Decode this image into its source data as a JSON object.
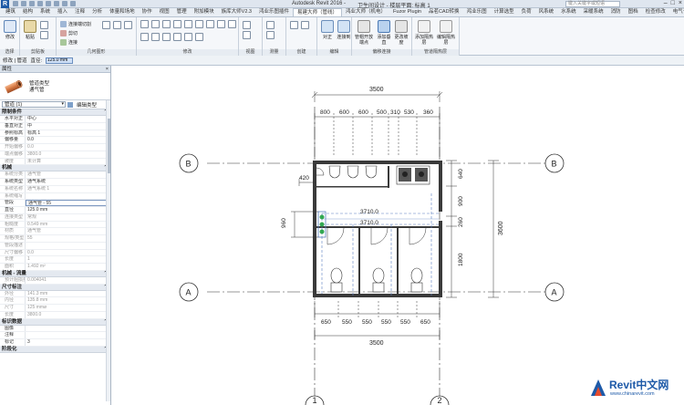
{
  "titlebar": {
    "app_name": "Autodesk Revit 2016 -",
    "file_name": "卫生间设计 - 楼层平面: 标高 1",
    "search_placeholder": "键入关键字或短语"
  },
  "tabs": [
    {
      "label": "建筑"
    },
    {
      "label": "结构"
    },
    {
      "label": "系统"
    },
    {
      "label": "插入"
    },
    {
      "label": "注释"
    },
    {
      "label": "分析"
    },
    {
      "label": "体量和场地"
    },
    {
      "label": "协作"
    },
    {
      "label": "视图"
    },
    {
      "label": "管理"
    },
    {
      "label": "附加模块"
    },
    {
      "label": "族库大师V2.3"
    },
    {
      "label": "鸿业乐图插件"
    },
    {
      "label": "易建大师（管线）"
    },
    {
      "label": "鸿业大师（机电）"
    },
    {
      "label": "Fuzor Plugin"
    },
    {
      "label": "品茗CAD转换"
    },
    {
      "label": "鸿业乐图"
    },
    {
      "label": "计算选型"
    },
    {
      "label": "负荷"
    },
    {
      "label": "风系统"
    },
    {
      "label": "水系统"
    },
    {
      "label": "采暖系统"
    },
    {
      "label": "消防"
    },
    {
      "label": "图档"
    },
    {
      "label": "检查修改"
    },
    {
      "label": "电气专业"
    }
  ],
  "ribbon": {
    "panels": [
      {
        "label": "选择"
      },
      {
        "label": "剪贴板"
      },
      {
        "label": "几何图形"
      },
      {
        "label": "修改"
      },
      {
        "label": "视图"
      },
      {
        "label": "测量"
      },
      {
        "label": "创建"
      },
      {
        "label": "编辑"
      },
      {
        "label": "偏移连接"
      },
      {
        "label": "管道隔热层"
      }
    ],
    "buttons": {
      "modify": "修改",
      "paste": "粘贴",
      "cut": "连接端切割",
      "cut2": "剪切",
      "join": "连接",
      "align": "对正",
      "connect": "连接到",
      "pipe": "管帽开放端点",
      "add_elbow": "添加垂直",
      "change_slope": "更改坡度",
      "add_insulation": "添加隔热层",
      "edit_insulation": "编辑隔热层"
    }
  },
  "options_bar": {
    "label1": "修改 | 管道",
    "diameter_label": "直径:",
    "diameter_value": "125.0 mm"
  },
  "properties": {
    "title": "属性",
    "close": "×",
    "type_family": "管道类型",
    "type_name": "通气管",
    "selector_value": "管道 (1)",
    "edit_type": "编辑类型",
    "groups": [
      {
        "title": "限制条件",
        "rows": [
          {
            "k": "水平对正",
            "v": "中心"
          },
          {
            "k": "垂直对正",
            "v": "中"
          },
          {
            "k": "参照标高",
            "v": "标高 1"
          },
          {
            "k": "偏移量",
            "v": "0.0"
          },
          {
            "k": "开始偏移",
            "v": "0.0",
            "dis": true
          },
          {
            "k": "端点偏移",
            "v": "3800.0",
            "dis": true
          },
          {
            "k": "坡度",
            "v": "未计算",
            "dis": true
          }
        ]
      },
      {
        "title": "机械",
        "rows": [
          {
            "k": "系统分类",
            "v": "通气管",
            "dis": true
          },
          {
            "k": "系统类型",
            "v": "通气系统"
          },
          {
            "k": "系统名称",
            "v": "通气系统 1",
            "dis": true
          },
          {
            "k": "系统缩写",
            "v": "",
            "dis": true
          },
          {
            "k": "管段",
            "v": "通气管 - 55",
            "hl": true
          },
          {
            "k": "直径",
            "v": "125.0 mm"
          },
          {
            "k": "连接类型",
            "v": "常规",
            "dis": true
          },
          {
            "k": "粗糙度",
            "v": "0.549 mm",
            "dis": true
          },
          {
            "k": "材质",
            "v": "通气管",
            "dis": true
          },
          {
            "k": "规格/类型",
            "v": "55",
            "dis": true
          },
          {
            "k": "管段描述",
            "v": "",
            "dis": true
          },
          {
            "k": "尺寸偏移",
            "v": "0.0",
            "dis": true
          },
          {
            "k": "长度",
            "v": "1",
            "dis": true
          },
          {
            "k": "面积",
            "v": "1.492 m²",
            "dis": true
          }
        ]
      },
      {
        "title": "机械 - 流量",
        "rows": [
          {
            "k": "预计阻损量",
            "v": "0.004041",
            "dis": true
          }
        ]
      },
      {
        "title": "尺寸标注",
        "rows": [
          {
            "k": "外径",
            "v": "141.3 mm",
            "dis": true
          },
          {
            "k": "内径",
            "v": "135.8 mm",
            "dis": true
          },
          {
            "k": "尺寸",
            "v": "125 mmø",
            "dis": true
          },
          {
            "k": "长度",
            "v": "3800.0",
            "dis": true
          }
        ]
      },
      {
        "title": "标识数据",
        "rows": [
          {
            "k": "图像",
            "v": ""
          },
          {
            "k": "注释",
            "v": ""
          },
          {
            "k": "标记",
            "v": "3"
          }
        ]
      },
      {
        "title": "阶段化",
        "rows": []
      }
    ]
  },
  "drawing": {
    "dim_total": "3500",
    "dim_top_parts": [
      "800",
      "600",
      "600",
      "500",
      "310",
      "530",
      "360"
    ],
    "dim_bottom_parts": [
      "650",
      "550",
      "550",
      "550",
      "550",
      "650"
    ],
    "dim_right_parts": [
      "640",
      "900",
      "260",
      "1800"
    ],
    "dim_right_total": "3600",
    "dim_left": "960",
    "dim_left_top": "420",
    "pipe_length_1": "3710.0",
    "pipe_length_2": "3710.0",
    "grid_B": "B",
    "grid_A": "A",
    "grid_1": "1",
    "grid_2": "2"
  },
  "watermark": {
    "title": "Revit中文网",
    "url": "www.chinarevit.com"
  }
}
